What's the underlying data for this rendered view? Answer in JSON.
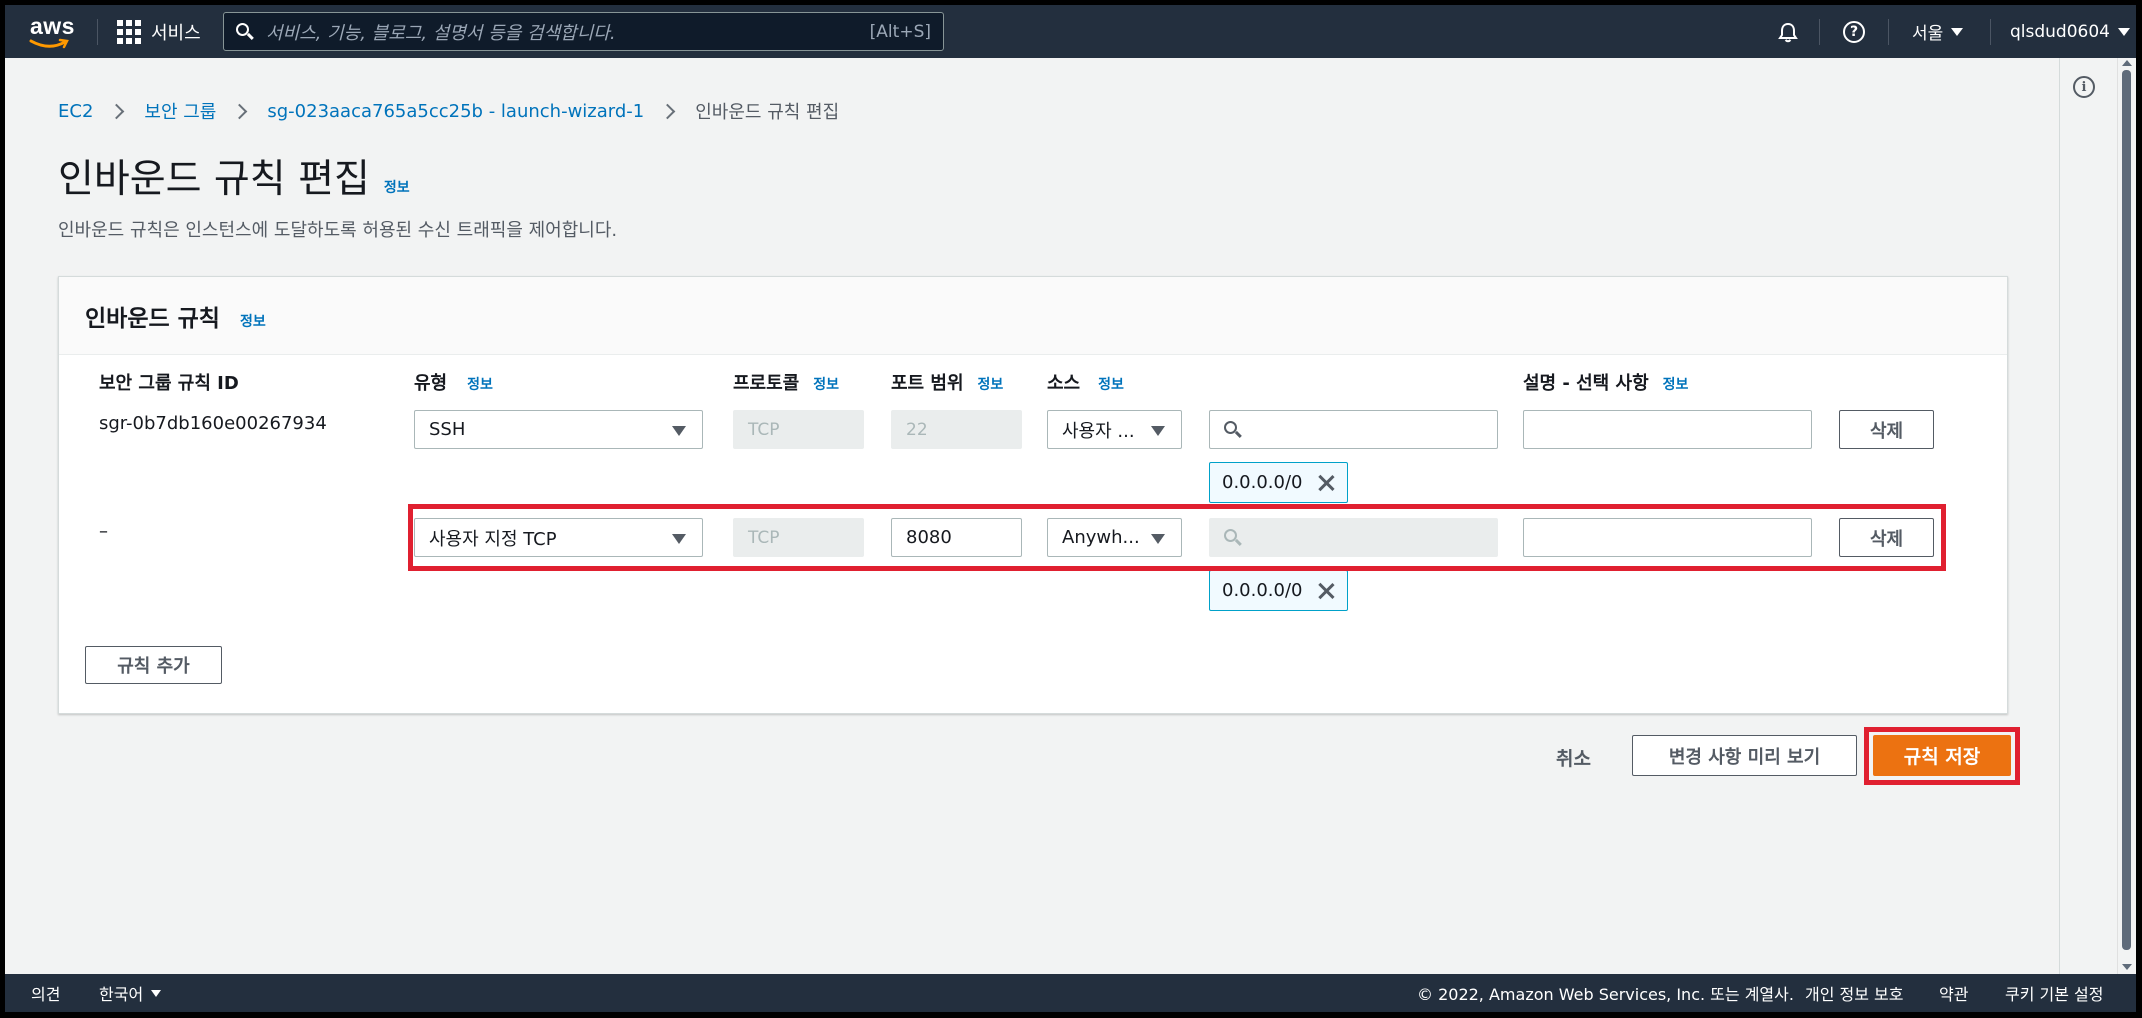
{
  "nav": {
    "logo_text": "aws",
    "services_label": "서비스",
    "search_placeholder": "서비스, 기능, 블로그, 설명서 등을 검색합니다.",
    "search_shortcut": "[Alt+S]",
    "region": "서울",
    "user": "qlsdud0604"
  },
  "breadcrumb": [
    "EC2",
    "보안 그룹",
    "sg-023aaca765a5cc25b - launch-wizard-1",
    "인바운드 규칙 편집"
  ],
  "page": {
    "title": "인바운드 규칙 편집",
    "info": "정보",
    "subtitle": "인바운드 규칙은 인스턴스에 도달하도록 허용된 수신 트래픽을 제어합니다."
  },
  "panel": {
    "title": "인바운드 규칙",
    "info": "정보",
    "columns": {
      "rule_id": "보안 그룹 규칙 ID",
      "type": "유형",
      "protocol": "프로토콜",
      "port_range": "포트 범위",
      "source": "소스",
      "description": "설명 - 선택 사항"
    },
    "rows": [
      {
        "rule_id": "sgr-0b7db160e00267934",
        "type": "SSH",
        "protocol": "TCP",
        "port_range": "22",
        "source": "사용자 ...",
        "cidr_token": "0.0.0.0/0",
        "delete": "삭제"
      },
      {
        "rule_id": "–",
        "type": "사용자 지정 TCP",
        "protocol": "TCP",
        "port_range": "8080",
        "source": "Anywh...",
        "cidr_token": "0.0.0.0/0",
        "delete": "삭제"
      }
    ],
    "add_rule": "규칙 추가"
  },
  "actions": {
    "cancel": "취소",
    "preview": "변경 사항 미리 보기",
    "save": "규칙 저장"
  },
  "footer": {
    "feedback": "의견",
    "language": "한국어",
    "copyright": "© 2022, Amazon Web Services, Inc. 또는 계열사.",
    "privacy": "개인 정보 보호",
    "terms": "약관",
    "cookies": "쿠키 기본 설정"
  },
  "colors": {
    "nav_bg": "#232f3e",
    "link": "#0073bb",
    "primary": "#ec7211",
    "highlight": "#e02030",
    "token_border": "#00a1c9"
  }
}
